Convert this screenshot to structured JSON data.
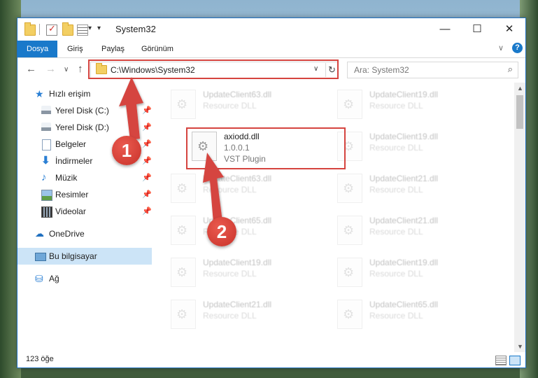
{
  "window": {
    "title": "System32",
    "minimize": "—",
    "maximize": "☐",
    "close": "✕"
  },
  "ribbon": {
    "tabs": [
      "Dosya",
      "Giriş",
      "Paylaş",
      "Görünüm"
    ],
    "active_tab": "Dosya",
    "help": "?",
    "expand": "∨"
  },
  "nav": {
    "back": "←",
    "forward": "→",
    "recent": "∨",
    "up": "↑",
    "address": "C:\\Windows\\System32",
    "address_dropdown": "∨",
    "refresh": "↻",
    "search_placeholder": "Ara: System32",
    "search_icon": "search-icon"
  },
  "sidebar": {
    "items": [
      {
        "label": "Hızlı erişim",
        "icon": "quick-access-star-icon"
      },
      {
        "label": "Yerel Disk (C:)",
        "icon": "drive-icon",
        "pinned": true
      },
      {
        "label": "Yerel Disk (D:)",
        "icon": "drive-icon",
        "pinned": true
      },
      {
        "label": "Belgeler",
        "icon": "documents-icon",
        "pinned": true
      },
      {
        "label": "İndirmeler",
        "icon": "downloads-icon",
        "pinned": true
      },
      {
        "label": "Müzik",
        "icon": "music-icon",
        "pinned": true
      },
      {
        "label": "Resimler",
        "icon": "pictures-icon",
        "pinned": true
      },
      {
        "label": "Videolar",
        "icon": "videos-icon",
        "pinned": true
      },
      {
        "label": "OneDrive",
        "icon": "onedrive-cloud-icon"
      },
      {
        "label": "Bu bilgisayar",
        "icon": "this-pc-icon",
        "selected": true
      },
      {
        "label": "Ağ",
        "icon": "network-icon"
      }
    ]
  },
  "files": {
    "highlighted": {
      "name": "axiodd.dll",
      "version": "1.0.0.1",
      "description": "VST Plugin"
    },
    "background_tiles": [
      {
        "name": "UpdateClient63.dll",
        "type": "Resource DLL"
      },
      {
        "name": "UpdateClient19.dll",
        "type": "Resource DLL"
      },
      {
        "name": "UpdateClient19.dll",
        "type": "Resource DLL"
      },
      {
        "name": "UpdateClient63.dll",
        "type": "Resource DLL"
      },
      {
        "name": "UpdateClient21.dll",
        "type": "Resource DLL"
      },
      {
        "name": "UpdateClient65.dll",
        "type": "Resource DLL"
      },
      {
        "name": "UpdateClient21.dll",
        "type": "Resource DLL"
      },
      {
        "name": "UpdateClient19.dll",
        "type": "Resource DLL"
      },
      {
        "name": "UpdateClient19.dll",
        "type": "Resource DLL"
      },
      {
        "name": "UpdateClient21.dll",
        "type": "Resource DLL"
      },
      {
        "name": "UpdateClient65.dll",
        "type": "Resource DLL"
      }
    ]
  },
  "status": {
    "item_count": "123 öğe"
  },
  "annotations": {
    "step1": "1",
    "step2": "2",
    "color": "#d5443f"
  }
}
